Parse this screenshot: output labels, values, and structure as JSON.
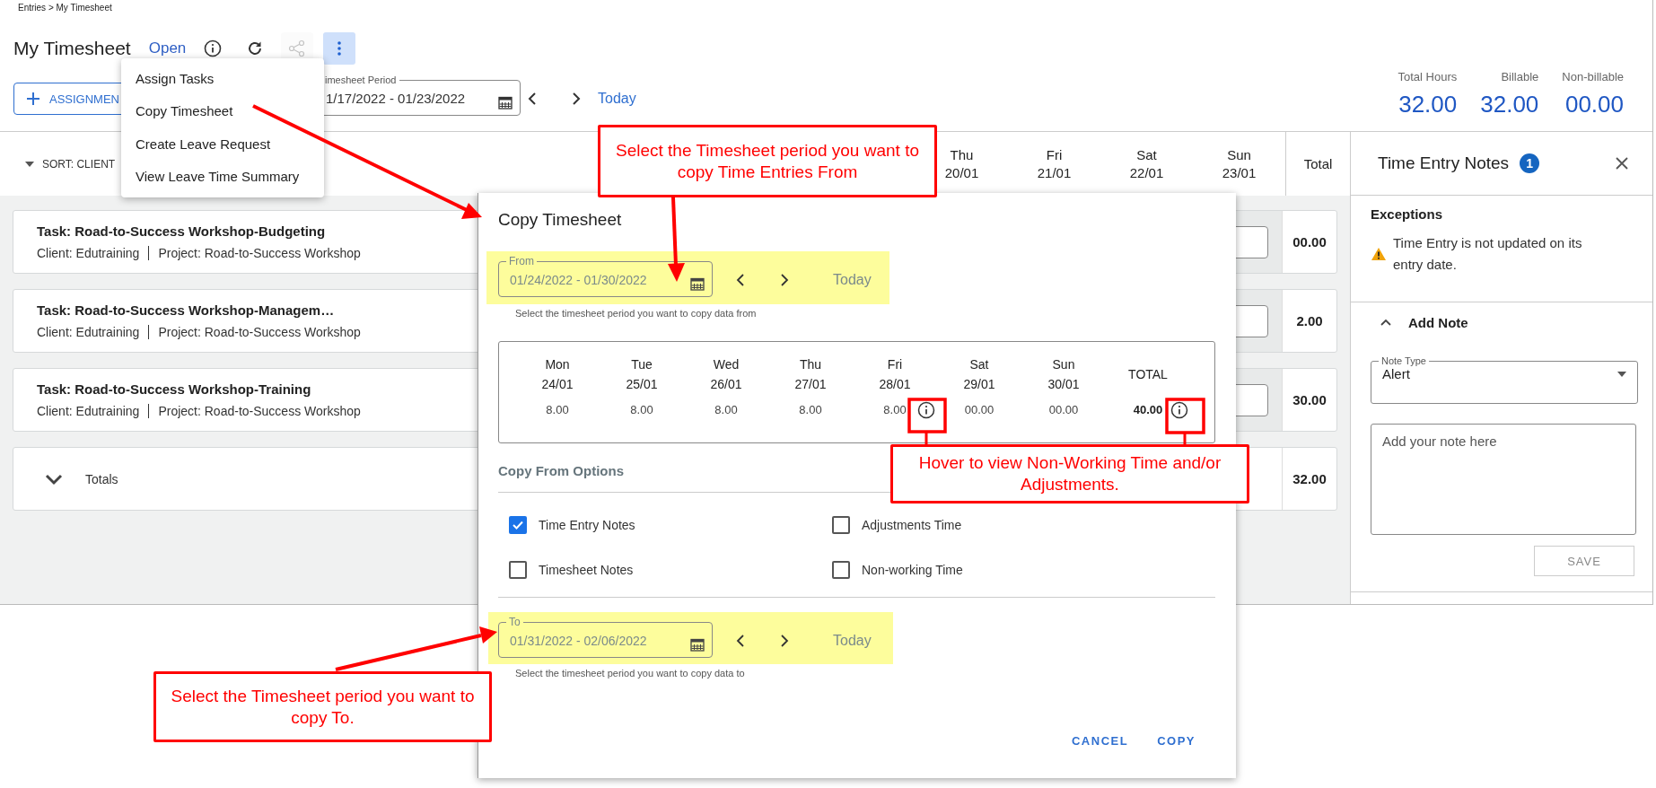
{
  "breadcrumb": "Entries > My Timesheet",
  "header": {
    "title": "My Timesheet",
    "status": "Open",
    "actions": [
      {
        "kind": "info",
        "disabled": false,
        "selected": false
      },
      {
        "kind": "refresh",
        "disabled": false,
        "selected": false
      },
      {
        "kind": "share",
        "disabled": true,
        "selected": false
      },
      {
        "kind": "more",
        "disabled": false,
        "selected": true
      }
    ]
  },
  "assign_button": "ASSIGNMEN",
  "period": {
    "label": "imesheet Period",
    "value": "1/17/2022 - 01/23/2022",
    "today": "Today"
  },
  "summary": [
    {
      "label": "Total Hours",
      "value": "32.00"
    },
    {
      "label": "Billable",
      "value": "32.00"
    },
    {
      "label": "Non-billable",
      "value": "00.00"
    }
  ],
  "grid": {
    "sort": "SORT: CLIENT",
    "columns": [
      {
        "day": "Thu",
        "date": "20/01"
      },
      {
        "day": "Fri",
        "date": "21/01"
      },
      {
        "day": "Sat",
        "date": "22/01"
      },
      {
        "day": "Sun",
        "date": "23/01"
      }
    ],
    "total_label": "Total",
    "tasks": [
      {
        "title": "Task: Road-to-Success Workshop-Budgeting",
        "client": "Client: Edutraining",
        "project": "Project: Road-to-Success Workshop",
        "total": "00.00"
      },
      {
        "title": "Task: Road-to-Success Workshop-Managem…",
        "client": "Client: Edutraining",
        "project": "Project: Road-to-Success Workshop",
        "total": "2.00"
      },
      {
        "title": "Task: Road-to-Success Workshop-Training",
        "client": "Client: Edutraining",
        "project": "Project: Road-to-Success Workshop",
        "total": "30.00"
      }
    ],
    "totals": {
      "label": "Totals",
      "expanded": false,
      "total": "32.00"
    }
  },
  "menu": [
    "Assign Tasks",
    "Copy Timesheet",
    "Create Leave Request",
    "View Leave Time Summary"
  ],
  "dialog": {
    "title": "Copy Timesheet",
    "from": {
      "label": "From",
      "value": "01/24/2022 - 01/30/2022",
      "today": "Today",
      "helper": "Select the timesheet period you want to copy data from"
    },
    "week": [
      {
        "day": "Mon",
        "date": "24/01",
        "value": "8.00",
        "info": false
      },
      {
        "day": "Tue",
        "date": "25/01",
        "value": "8.00",
        "info": false
      },
      {
        "day": "Wed",
        "date": "26/01",
        "value": "8.00",
        "info": false
      },
      {
        "day": "Thu",
        "date": "27/01",
        "value": "8.00",
        "info": false
      },
      {
        "day": "Fri",
        "date": "28/01",
        "value": "8.00",
        "info": true
      },
      {
        "day": "Sat",
        "date": "29/01",
        "value": "00.00",
        "info": false
      },
      {
        "day": "Sun",
        "date": "30/01",
        "value": "00.00",
        "info": false
      }
    ],
    "total": {
      "label": "TOTAL",
      "value": "40.00",
      "info": true
    },
    "options_title": "Copy From Options",
    "options": [
      {
        "label": "Time Entry Notes",
        "checked": true
      },
      {
        "label": "Adjustments Time",
        "checked": false
      },
      {
        "label": "Timesheet Notes",
        "checked": false
      },
      {
        "label": "Non-working Time",
        "checked": false
      }
    ],
    "to": {
      "label": "To",
      "value": "01/31/2022 - 02/06/2022",
      "today": "Today",
      "helper": "Select the timesheet period you want to copy data to"
    },
    "buttons": [
      "CANCEL",
      "COPY"
    ]
  },
  "notes_panel": {
    "title": "Time Entry Notes",
    "count": "1",
    "exceptions_title": "Exceptions",
    "exceptions": [
      "Time Entry is not updated on its entry date."
    ],
    "add_note": {
      "title": "Add Note",
      "expanded": true,
      "note_type": {
        "label": "Note Type",
        "value": "Alert"
      },
      "placeholder": "Add your note here",
      "save": {
        "label": "SAVE",
        "disabled": true
      }
    }
  },
  "annotations": [
    {
      "text": "Select the Timesheet period you want to copy Time Entries From"
    },
    {
      "text": "Hover to view Non-Working Time and/or Adjustments."
    },
    {
      "text": "Select the Timesheet period you want to copy To."
    }
  ]
}
